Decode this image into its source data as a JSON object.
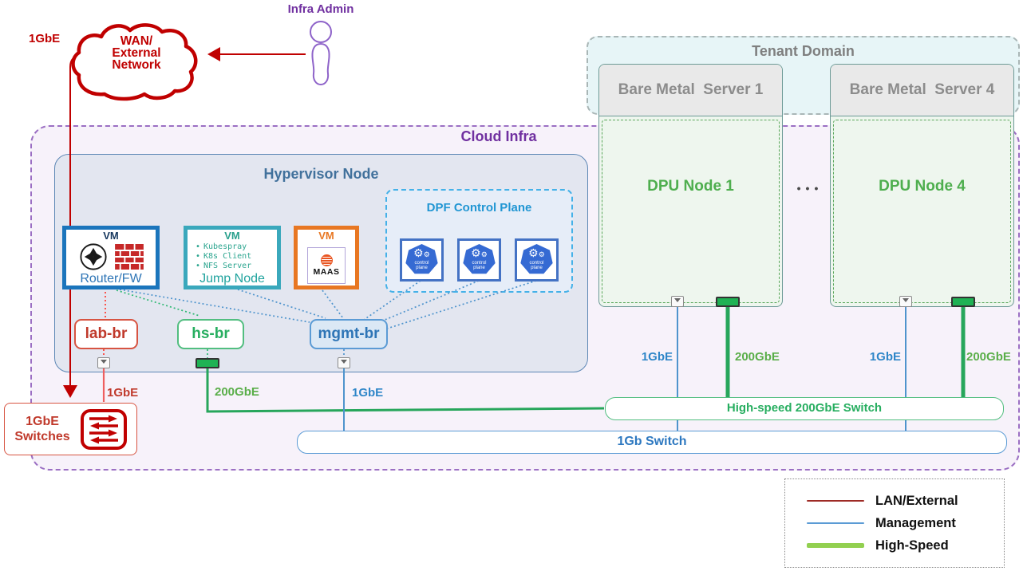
{
  "titles": {
    "cloud_infra": "Cloud Infra",
    "hypervisor": "Hypervisor Node",
    "tenant_domain": "Tenant Domain",
    "dpf": "DPF Control Plane"
  },
  "admin": {
    "label": "Infra Admin"
  },
  "wan": {
    "lines": [
      "WAN/",
      "External",
      "Network"
    ]
  },
  "vms": {
    "router": {
      "tag": "VM",
      "label": "Router/FW"
    },
    "jump": {
      "tag": "VM",
      "label": "Jump Node",
      "items": [
        "Kubespray",
        "K8s Client",
        "NFS Server"
      ]
    },
    "maas": {
      "tag": "VM",
      "logo_text": "MAAS"
    }
  },
  "icons": {
    "gear": "⚙",
    "bullet": "•"
  },
  "control_plane_icon": {
    "line1": "control",
    "line2": "plane"
  },
  "bridges": {
    "lab": "lab-br",
    "hs": "hs-br",
    "mgmt": "mgmt-br"
  },
  "servers": {
    "bm1": {
      "title": "Bare Metal  Server 1",
      "dpu": "DPU Node 1"
    },
    "bm4": {
      "title": "Bare Metal  Server 4",
      "dpu": "DPU Node 4"
    },
    "ellipsis": "•••"
  },
  "switches": {
    "lan": {
      "line1": "1GbE",
      "line2": "Switches"
    },
    "highspeed": "High-speed 200GbE Switch",
    "onegb": "1Gb Switch"
  },
  "link_labels": {
    "wan_uplink": "1GbE",
    "lab_down": "1GbE",
    "hs_down": "200GbE",
    "mgmt_down": "1GbE",
    "dpu1_mgmt": "1GbE",
    "dpu1_hs": "200GbE",
    "dpu4_mgmt": "1GbE",
    "dpu4_hs": "200GbE"
  },
  "legend": {
    "items": [
      {
        "label": "LAN/External",
        "color": "#9e2b25"
      },
      {
        "label": "Management",
        "color": "#5b9bd5"
      },
      {
        "label": "High-Speed",
        "color": "#92d050"
      }
    ]
  },
  "colors": {
    "lan_external_red": "#c00000",
    "management_blue": "#5b9bd5",
    "high_speed_green": "#27a65b",
    "cloud_infra_purple": "#7030a0"
  }
}
